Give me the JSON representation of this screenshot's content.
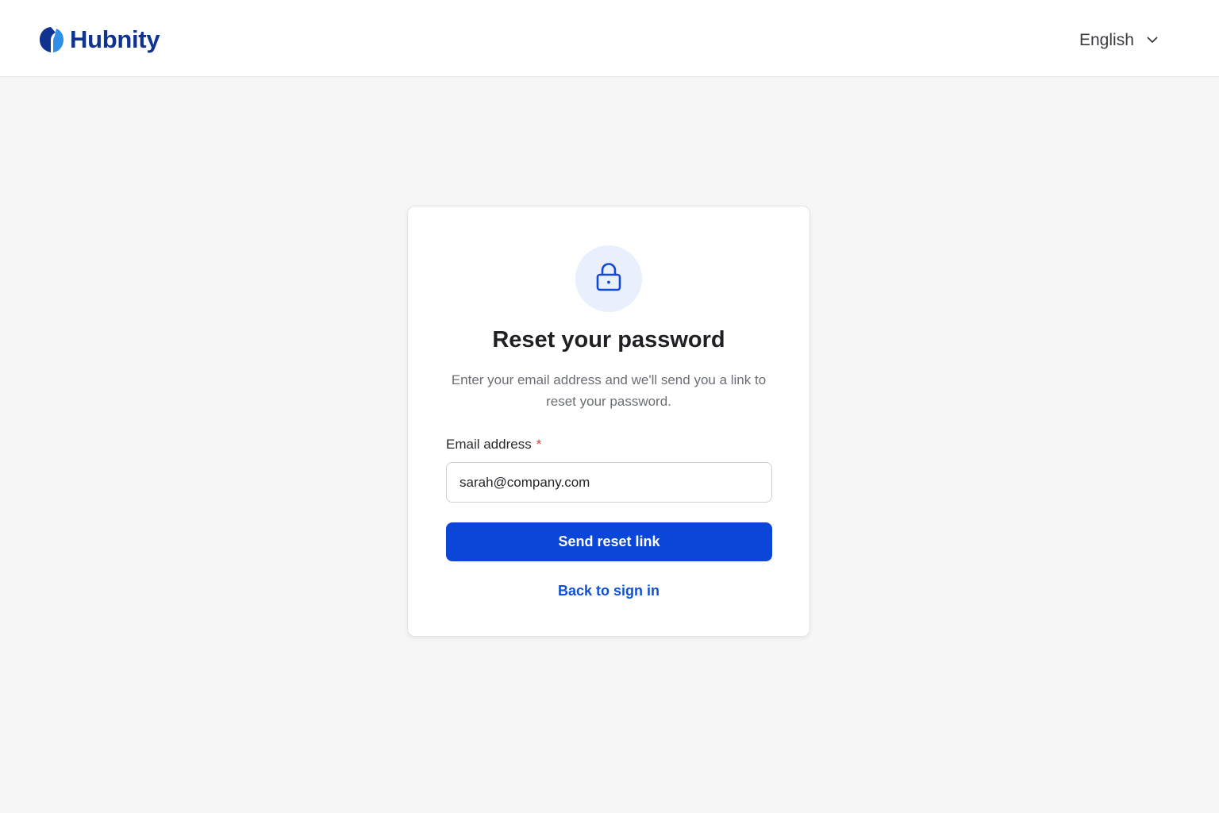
{
  "header": {
    "brand_name": "Hubnity",
    "language": "English",
    "logo_icon": "hubnity-logo-icon",
    "language_icon": "chevron-down-icon"
  },
  "card": {
    "icon": "lock-icon",
    "title": "Reset your password",
    "subtitle": "Enter your email address and we'll send you a link to reset your password.",
    "email_label": "Email address",
    "required_marker": "*",
    "email_value": "sarah@company.com",
    "submit_label": "Send reset link",
    "back_link_label": "Back to sign in"
  },
  "colors": {
    "brand": "#10338f",
    "primary_button": "#0b46d8",
    "link": "#1150d6",
    "icon_circle": "#e9effc",
    "required": "#e03a3a",
    "page_background": "#f6f6f7"
  }
}
